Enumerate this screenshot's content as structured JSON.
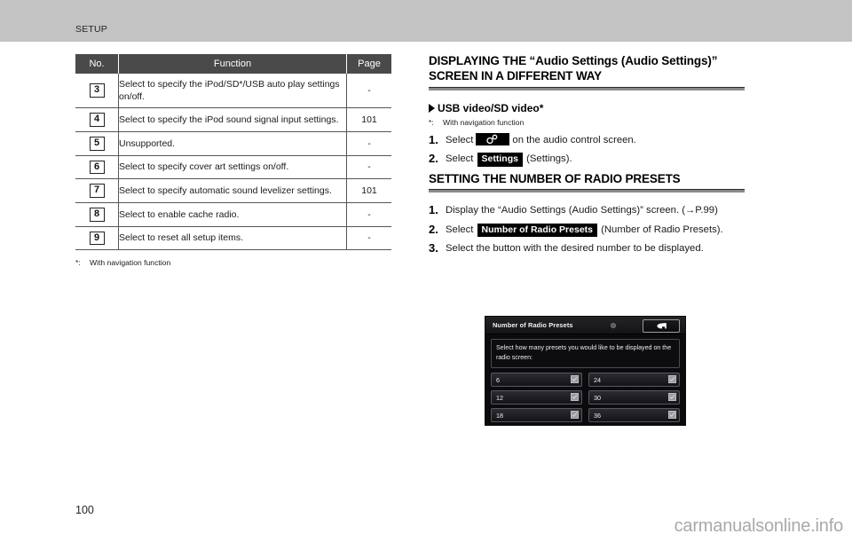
{
  "header": {
    "section": "SETUP"
  },
  "table": {
    "columns": [
      "No.",
      "Function",
      "Page"
    ],
    "rows": [
      {
        "no": "3",
        "function": "Select to specify the iPod/SD*/USB auto play settings on/off.",
        "page": "-"
      },
      {
        "no": "4",
        "function": "Select to specify the iPod sound signal input settings.",
        "page": "101"
      },
      {
        "no": "5",
        "function": "Unsupported.",
        "page": "-"
      },
      {
        "no": "6",
        "function": "Select to specify cover art settings on/off.",
        "page": "-"
      },
      {
        "no": "7",
        "function": "Select to specify automatic sound levelizer settings.",
        "page": "101"
      },
      {
        "no": "8",
        "function": "Select to enable cache radio.",
        "page": "-"
      },
      {
        "no": "9",
        "function": "Select to reset all setup items.",
        "page": "-"
      }
    ],
    "footnote_mark": "*:",
    "footnote_text": "With navigation function"
  },
  "right": {
    "heading1": "DISPLAYING THE “Audio Settings (Audio Settings)” SCREEN IN A DIFFERENT WAY",
    "subhead1": "USB video/SD video*",
    "subnote_mark": "*:",
    "subnote_text": "With navigation function",
    "steps1": [
      {
        "num": "1.",
        "pre": "Select",
        "chip_icon": "settings-gear-icon",
        "post": "on the audio control screen."
      },
      {
        "num": "2.",
        "pre": "Select",
        "chip": "Settings",
        "post": "(Settings)."
      }
    ],
    "heading2": "SETTING THE NUMBER OF RADIO PRESETS",
    "steps2": [
      {
        "num": "1.",
        "text": "Display the “Audio Settings (Audio Settings)” screen. (→P.99)"
      },
      {
        "num": "2.",
        "pre": "Select",
        "chip": "Number of Radio Presets",
        "post": "(Number of Radio Presets)."
      },
      {
        "num": "3.",
        "text": "Select the button with the desired number to be displayed."
      }
    ]
  },
  "device": {
    "title": "Number of Radio Presets",
    "back_icon": "return-arrow-icon",
    "status_icon": "indicator-dot-icon",
    "message": "Select how many presets you would like to be displayed on the radio screen:",
    "buttons": [
      "6",
      "24",
      "12",
      "30",
      "18",
      "36"
    ]
  },
  "footer": {
    "page_number": "100",
    "watermark": "carmanualsonline.info"
  }
}
